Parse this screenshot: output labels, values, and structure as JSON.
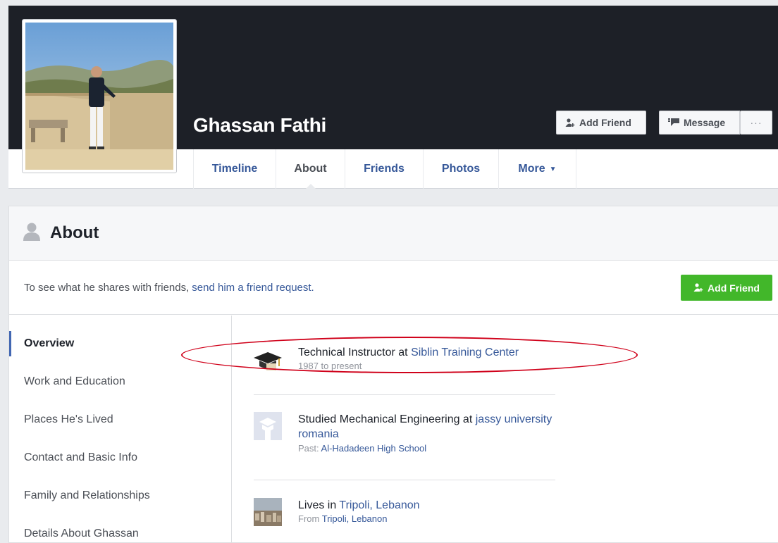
{
  "profile": {
    "name": "Ghassan Fathi",
    "add_friend_label": "Add Friend",
    "message_label": "Message",
    "more_dots": "···"
  },
  "tabs": [
    {
      "label": "Timeline"
    },
    {
      "label": "About"
    },
    {
      "label": "Friends"
    },
    {
      "label": "Photos"
    },
    {
      "label": "More"
    }
  ],
  "about": {
    "title": "About",
    "note_prefix": "To see what he shares with friends,",
    "note_link": "send him a friend request.",
    "add_friend_label": "Add Friend"
  },
  "side_nav": [
    {
      "label": "Overview"
    },
    {
      "label": "Work and Education"
    },
    {
      "label": "Places He's Lived"
    },
    {
      "label": "Contact and Basic Info"
    },
    {
      "label": "Family and Relationships"
    },
    {
      "label": "Details About Ghassan"
    }
  ],
  "entries": {
    "work": {
      "text": "Technical Instructor at",
      "link": "Siblin Training Center",
      "sub": "1987 to present"
    },
    "education": {
      "text": "Studied Mechanical Engineering at",
      "link": "jassy university romania",
      "sub_prefix": "Past:",
      "sub_link": "Al-Hadadeen High School"
    },
    "places": {
      "text": "Lives in",
      "link": "Tripoli, Lebanon",
      "sub_prefix": "From",
      "sub_link": "Tripoli, Lebanon"
    }
  },
  "colors": {
    "link": "#365899",
    "cover": "#1d2027",
    "green_button": "#42b72a",
    "highlight": "#d0021b"
  }
}
